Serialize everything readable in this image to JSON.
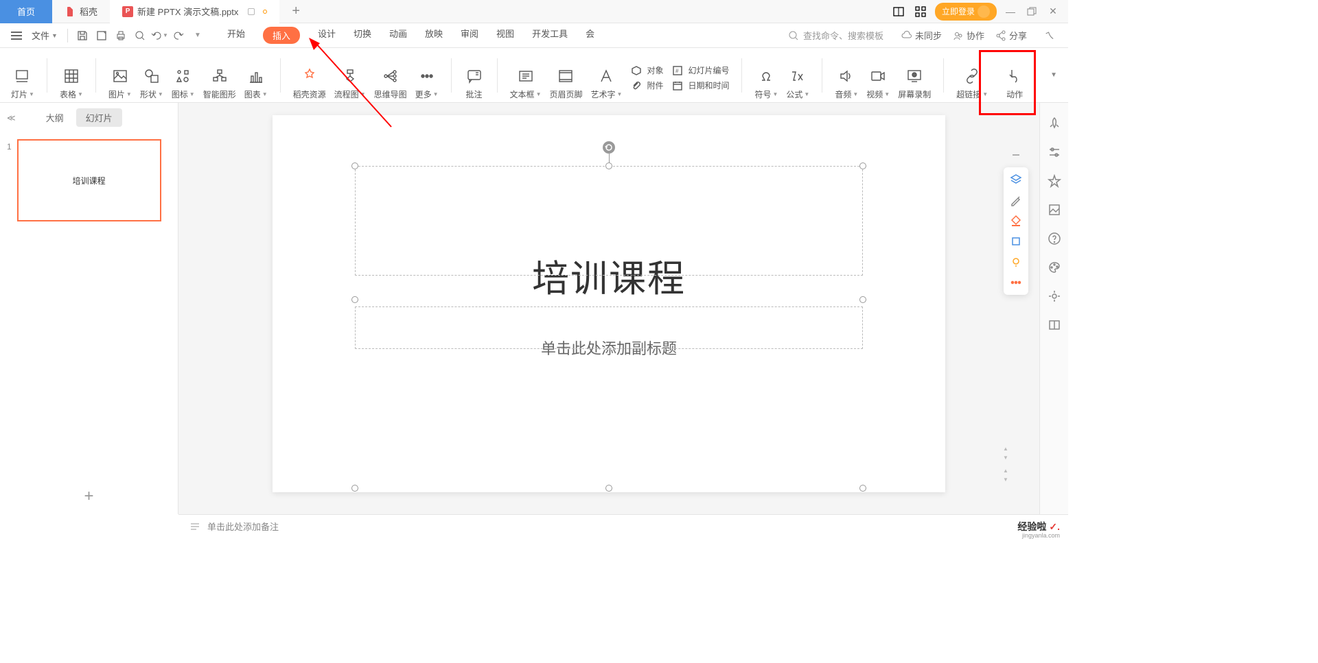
{
  "title_bar": {
    "home_tab": "首页",
    "docer_tab": "稻壳",
    "current_doc": "新建 PPTX 演示文稿.pptx",
    "plus": "+",
    "login": "立即登录"
  },
  "menu": {
    "file": "文件",
    "tabs": [
      "开始",
      "插入",
      "设计",
      "切换",
      "动画",
      "放映",
      "审阅",
      "视图",
      "开发工具",
      "会"
    ],
    "active_index": 1,
    "search_placeholder": "查找命令、搜索模板",
    "nosync": "未同步",
    "collab": "协作",
    "share": "分享"
  },
  "ribbon": {
    "new_slide": "灯片",
    "table": "表格",
    "picture": "图片",
    "shape": "形状",
    "icon": "图标",
    "smartart": "智能图形",
    "chart": "图表",
    "docer_res": "稻壳资源",
    "flowchart": "流程图",
    "mindmap": "思维导图",
    "more": "更多",
    "comment": "批注",
    "textbox": "文本框",
    "header_footer": "页眉页脚",
    "wordart": "艺术字",
    "object": "对象",
    "slide_number": "幻灯片编号",
    "attachment": "附件",
    "datetime": "日期和时间",
    "symbol": "符号",
    "equation": "公式",
    "audio": "音频",
    "video": "视频",
    "screen_record": "屏幕录制",
    "hyperlink": "超链接",
    "action": "动作"
  },
  "left_panel": {
    "outline": "大纲",
    "slides": "幻灯片",
    "slide_num": "1",
    "thumb_text": "培训课程",
    "add": "+"
  },
  "slide": {
    "title": "培训课程",
    "subtitle": "单击此处添加副标题"
  },
  "notes": "单击此处添加备注",
  "watermark": {
    "text": "经验啦",
    "url": "jingyanla.com"
  }
}
